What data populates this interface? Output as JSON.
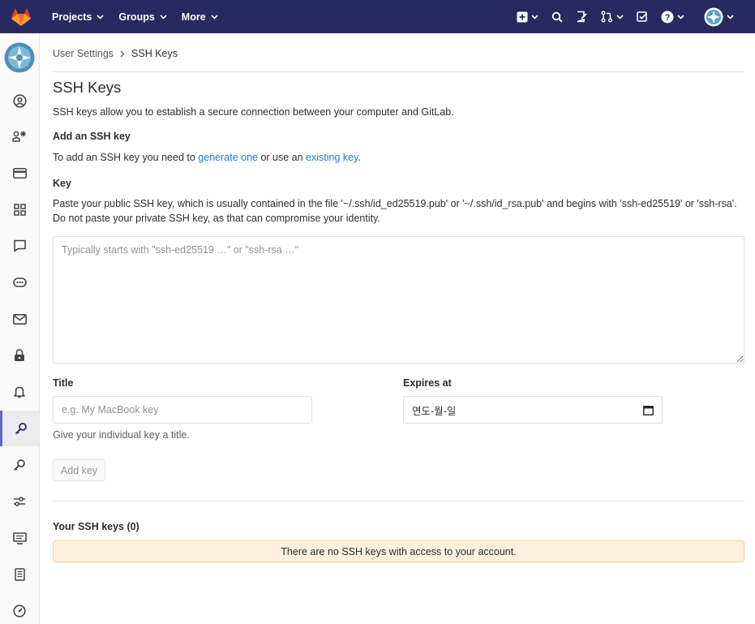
{
  "navbar": {
    "projects": "Projects",
    "groups": "Groups",
    "more": "More"
  },
  "breadcrumb": {
    "parent": "User Settings",
    "current": "SSH Keys"
  },
  "page": {
    "title": "SSH Keys",
    "intro": "SSH keys allow you to establish a secure connection between your computer and GitLab.",
    "add_title": "Add an SSH key",
    "add_prefix": "To add an SSH key you need to ",
    "generate_link": "generate one",
    "add_middle": " or use an ",
    "existing_link": "existing key",
    "add_suffix": "."
  },
  "form": {
    "key_label": "Key",
    "key_help": "Paste your public SSH key, which is usually contained in the file '~/.ssh/id_ed25519.pub' or '~/.ssh/id_rsa.pub' and begins with 'ssh-ed25519' or 'ssh-rsa'. Do not paste your private SSH key, as that can compromise your identity.",
    "key_placeholder": "Typically starts with \"ssh-ed25519 …\" or \"ssh-rsa …\"",
    "key_value": "",
    "title_label": "Title",
    "title_placeholder": "e.g. My MacBook key",
    "title_value": "",
    "title_help": "Give your individual key a title.",
    "expires_label": "Expires at",
    "expires_value": "연도-월-일",
    "submit": "Add key"
  },
  "keys": {
    "heading": "Your SSH keys (0)",
    "empty": "There are no SSH keys with access to your account."
  },
  "colors": {
    "navbar": "#292961",
    "link": "#1f78d1",
    "active_border": "#6666c4",
    "warning_bg": "#fdf1dd",
    "warning_border": "#f1d099"
  }
}
